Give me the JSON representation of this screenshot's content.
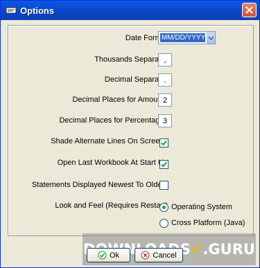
{
  "window": {
    "title": "Options"
  },
  "fields": {
    "date_format_label": "Date Format",
    "date_format_value": "MM/DD/YYYY",
    "thousands_label": "Thousands Separator",
    "thousands_value": ",",
    "decimal_sep_label": "Decimal Separator",
    "decimal_sep_value": ".",
    "decimal_amounts_label": "Decimal Places for Amounts",
    "decimal_amounts_value": "2",
    "decimal_percent_label": "Decimal Places for Percentages",
    "decimal_percent_value": "3",
    "shade_label": "Shade Alternate Lines On Screens",
    "open_last_label": "Open Last Workbook At Start Up",
    "newest_label": "Statements Displayed Newest To Oldest",
    "look_feel_label": "Look and Feel (Requires Restart)",
    "radio_os_label": "Operating System",
    "radio_cross_label": "Cross Platform (Java)"
  },
  "state": {
    "shade_checked": true,
    "open_last_checked": true,
    "newest_checked": false,
    "look_feel_selected": "Operating System"
  },
  "buttons": {
    "ok_label": "Ok",
    "cancel_label": "Cancel"
  },
  "watermark": {
    "text_left": "DOWNLOADS",
    "text_right": ".GURU"
  },
  "colors": {
    "titlebar": "#0a58e6",
    "check": "#21a121",
    "close": "#d4522f"
  }
}
